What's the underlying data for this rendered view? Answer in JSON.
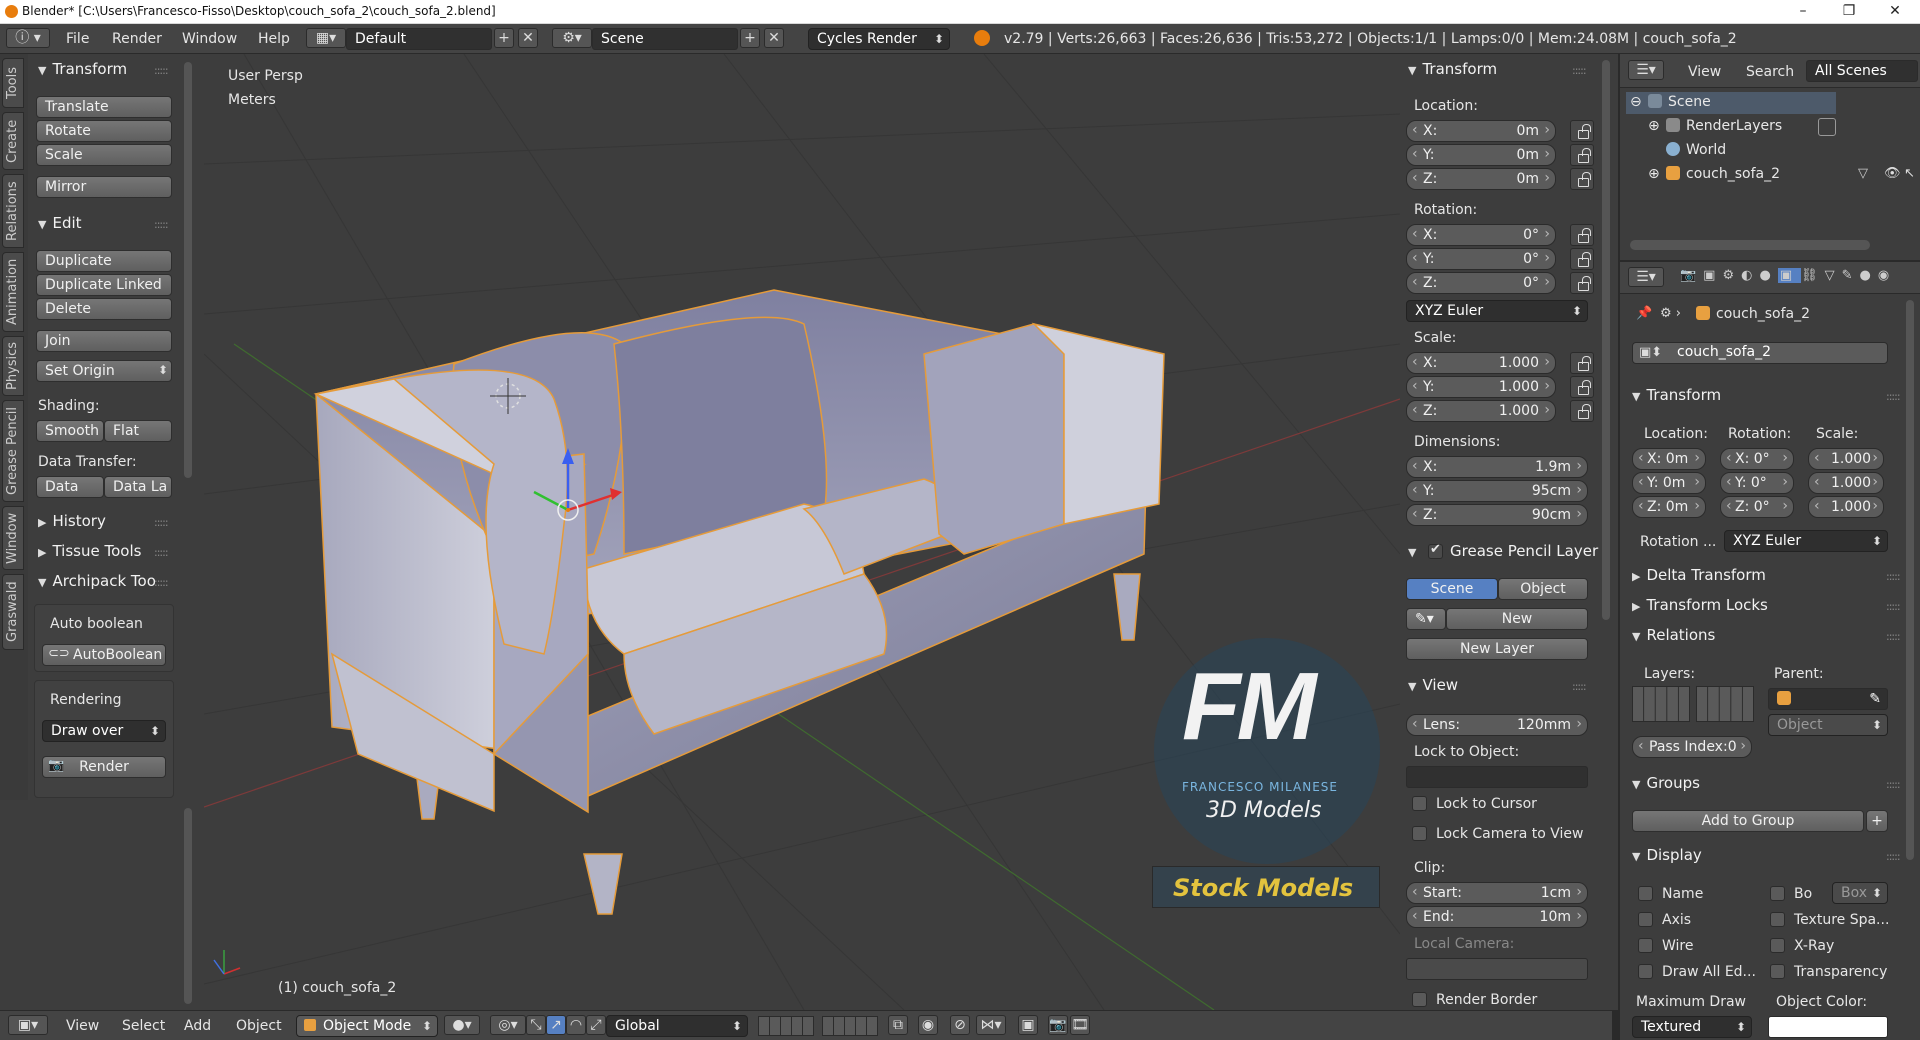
{
  "window": {
    "title": "Blender* [C:\\Users\\Francesco-Fisso\\Desktop\\couch_sofa_2\\couch_sofa_2.blend]"
  },
  "topbar": {
    "menus": [
      "File",
      "Render",
      "Window",
      "Help"
    ],
    "layout": "Default",
    "scene": "Scene",
    "engine": "Cycles Render",
    "stats": "v2.79 | Verts:26,663 | Faces:26,636 | Tris:53,272 | Objects:1/1 | Lamps:0/0 | Mem:24.08M | couch_sofa_2"
  },
  "tabs": [
    "Tools",
    "Create",
    "Relations",
    "Animation",
    "Physics",
    "Grease Pencil",
    "Window",
    "Graswald"
  ],
  "tools": {
    "transform_header": "Transform",
    "translate": "Translate",
    "rotate": "Rotate",
    "scale": "Scale",
    "mirror": "Mirror",
    "edit_header": "Edit",
    "duplicate": "Duplicate",
    "duplicate_linked": "Duplicate Linked",
    "delete": "Delete",
    "join": "Join",
    "set_origin": "Set Origin",
    "shading_label": "Shading:",
    "smooth": "Smooth",
    "flat": "Flat",
    "data_transfer_label": "Data Transfer:",
    "data": "Data",
    "data_la": "Data La",
    "history": "History",
    "tissue": "Tissue Tools",
    "archipack": "Archipack Too",
    "auto_boolean_label": "Auto boolean",
    "auto_boolean_btn": "AutoBoolean",
    "rendering_label": "Rendering",
    "draw_over": "Draw over",
    "render_btn": "Render"
  },
  "viewport": {
    "view_name": "User Persp",
    "units": "Meters",
    "object_label": "(1) couch_sofa_2",
    "logo_main": "FM",
    "logo_name": "FRANCESCO MILANESE",
    "logo_sub": "3D Models",
    "stock": "Stock Models"
  },
  "properties_n": {
    "transform_header": "Transform",
    "location_label": "Location:",
    "loc": [
      {
        "k": "X:",
        "v": "0m"
      },
      {
        "k": "Y:",
        "v": "0m"
      },
      {
        "k": "Z:",
        "v": "0m"
      }
    ],
    "rotation_label": "Rotation:",
    "rot": [
      {
        "k": "X:",
        "v": "0°"
      },
      {
        "k": "Y:",
        "v": "0°"
      },
      {
        "k": "Z:",
        "v": "0°"
      }
    ],
    "rotation_mode": "XYZ Euler",
    "scale_label": "Scale:",
    "scale": [
      {
        "k": "X:",
        "v": "1.000"
      },
      {
        "k": "Y:",
        "v": "1.000"
      },
      {
        "k": "Z:",
        "v": "1.000"
      }
    ],
    "dimensions_label": "Dimensions:",
    "dim": [
      {
        "k": "X:",
        "v": "1.9m"
      },
      {
        "k": "Y:",
        "v": "95cm"
      },
      {
        "k": "Z:",
        "v": "90cm"
      }
    ],
    "grease_header": "Grease Pencil Layer",
    "scene_tab": "Scene",
    "object_tab": "Object",
    "new": "New",
    "new_layer": "New Layer",
    "view_header": "View",
    "lens_k": "Lens:",
    "lens_v": "120mm",
    "lock_to_object": "Lock to Object:",
    "lock_to_cursor": "Lock to Cursor",
    "lock_camera": "Lock Camera to View",
    "clip_label": "Clip:",
    "clip_start_k": "Start:",
    "clip_start_v": "1cm",
    "clip_end_k": "End:",
    "clip_end_v": "10m",
    "local_camera": "Local Camera:",
    "render_border": "Render Border"
  },
  "outliner": {
    "view": "View",
    "search": "Search",
    "all_scenes": "All Scenes",
    "items": [
      "Scene",
      "RenderLayers",
      "World",
      "couch_sofa_2"
    ]
  },
  "props": {
    "object_name": "couch_sofa_2",
    "transform_header": "Transform",
    "location_label": "Location:",
    "rotation_label": "Rotation:",
    "scale_label": "Scale:",
    "loc": [
      "X: 0m",
      "Y: 0m",
      "Z: 0m"
    ],
    "rot": [
      "X:   0°",
      "Y:   0°",
      "Z:   0°"
    ],
    "scale": [
      "1.000",
      "1.000",
      "1.000"
    ],
    "rotation_mode_label": "Rotation ...",
    "rotation_mode": "XYZ Euler",
    "delta_transform": "Delta Transform",
    "transform_locks": "Transform Locks",
    "relations": "Relations",
    "layers_label": "Layers:",
    "parent_label": "Parent:",
    "parent_type": "Object",
    "pass_index": "Pass Index:0",
    "groups": "Groups",
    "add_to_group": "Add to Group",
    "display": "Display",
    "name": "Name",
    "bo": "Bo",
    "box": "Box",
    "axis": "Axis",
    "texture_space": "Texture Spa...",
    "wire": "Wire",
    "xray": "X-Ray",
    "draw_all_edges": "Draw All Ed...",
    "transparency": "Transparency",
    "max_draw": "Maximum Draw",
    "object_color": "Object Color:",
    "textured": "Textured"
  },
  "bottombar": {
    "view": "View",
    "select": "Select",
    "add": "Add",
    "object": "Object",
    "mode": "Object Mode",
    "orientation": "Global"
  }
}
